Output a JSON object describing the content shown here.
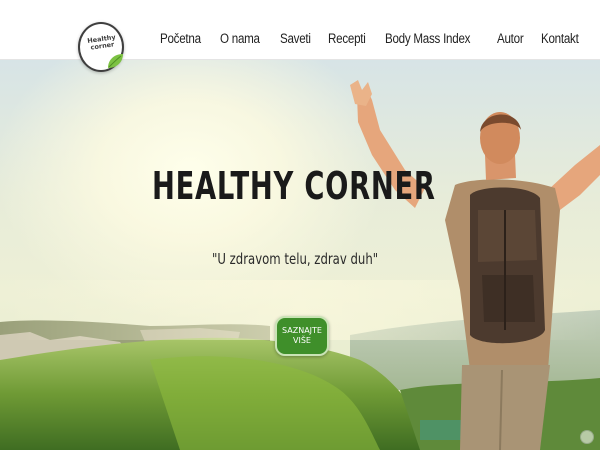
{
  "logo": {
    "line1": "Healthy",
    "line2": "corner",
    "icon": "leaf-icon"
  },
  "nav": {
    "items": [
      {
        "label": "Početna"
      },
      {
        "label": "O nama"
      },
      {
        "label": "Saveti"
      },
      {
        "label": "Recepti"
      },
      {
        "label": "Body Mass Index"
      },
      {
        "label": "Autor"
      },
      {
        "label": "Kontakt"
      }
    ]
  },
  "hero": {
    "title": "HEALTHY CORNER",
    "quote": "\"U zdravom telu, zdrav duh\"",
    "cta_label": "SAZNAJTE VIŠE"
  },
  "colors": {
    "accent": "#3f8f2a",
    "text": "#1a1a1a",
    "header_bg": "#ffffff"
  }
}
